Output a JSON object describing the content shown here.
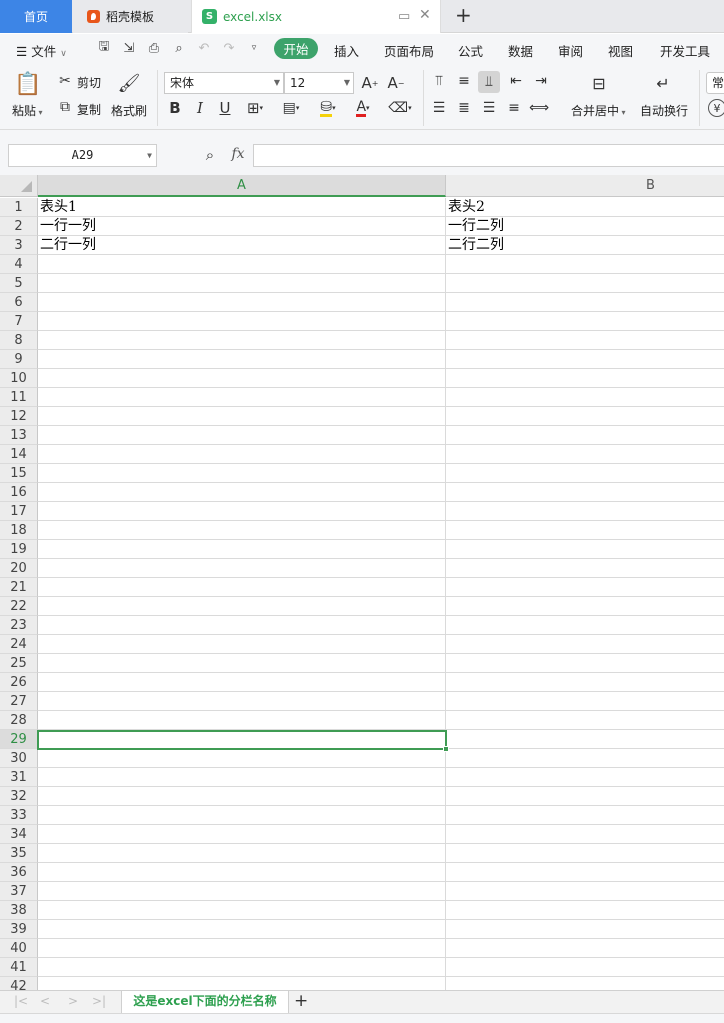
{
  "tabs": {
    "home": "首页",
    "template": "稻壳模板",
    "file": "excel.xlsx",
    "file_icon": "S"
  },
  "menu": {
    "file": "文件",
    "items": [
      "开始",
      "插入",
      "页面布局",
      "公式",
      "数据",
      "审阅",
      "视图",
      "开发工具"
    ]
  },
  "ribbon": {
    "paste": "粘贴",
    "cut": "剪切",
    "copy": "复制",
    "format_painter": "格式刷",
    "font_name": "宋体",
    "font_size": "12",
    "merge_center": "合并居中",
    "auto_wrap": "自动换行",
    "number_format": "常"
  },
  "formula_bar": {
    "name_box": "A29",
    "fx_label": "fx",
    "formula": ""
  },
  "sheet": {
    "columns": [
      "A",
      "B"
    ],
    "selected_row": 29,
    "rows": [
      {
        "n": 1,
        "a": "表头1",
        "b": "表头2"
      },
      {
        "n": 2,
        "a": "一行一列",
        "b": "一行二列"
      },
      {
        "n": 3,
        "a": "二行一列",
        "b": "二行二列"
      },
      {
        "n": 4
      },
      {
        "n": 5
      },
      {
        "n": 6
      },
      {
        "n": 7
      },
      {
        "n": 8
      },
      {
        "n": 9
      },
      {
        "n": 10
      },
      {
        "n": 11
      },
      {
        "n": 12
      },
      {
        "n": 13
      },
      {
        "n": 14
      },
      {
        "n": 15
      },
      {
        "n": 16
      },
      {
        "n": 17
      },
      {
        "n": 18
      },
      {
        "n": 19
      },
      {
        "n": 20
      },
      {
        "n": 21
      },
      {
        "n": 22
      },
      {
        "n": 23
      },
      {
        "n": 24
      },
      {
        "n": 25
      },
      {
        "n": 26
      },
      {
        "n": 27
      },
      {
        "n": 28
      },
      {
        "n": 29
      },
      {
        "n": 30
      },
      {
        "n": 31
      },
      {
        "n": 32
      },
      {
        "n": 33
      },
      {
        "n": 34
      },
      {
        "n": 35
      },
      {
        "n": 36
      },
      {
        "n": 37
      },
      {
        "n": 38
      },
      {
        "n": 39
      },
      {
        "n": 40
      },
      {
        "n": 41
      },
      {
        "n": 42
      }
    ]
  },
  "sheet_tabs": {
    "active": "这是excel下面的分栏名称"
  },
  "colors": {
    "accent_green": "#3f9c54",
    "home_tab_blue": "#3d85e6",
    "start_pill": "#3da36b"
  }
}
